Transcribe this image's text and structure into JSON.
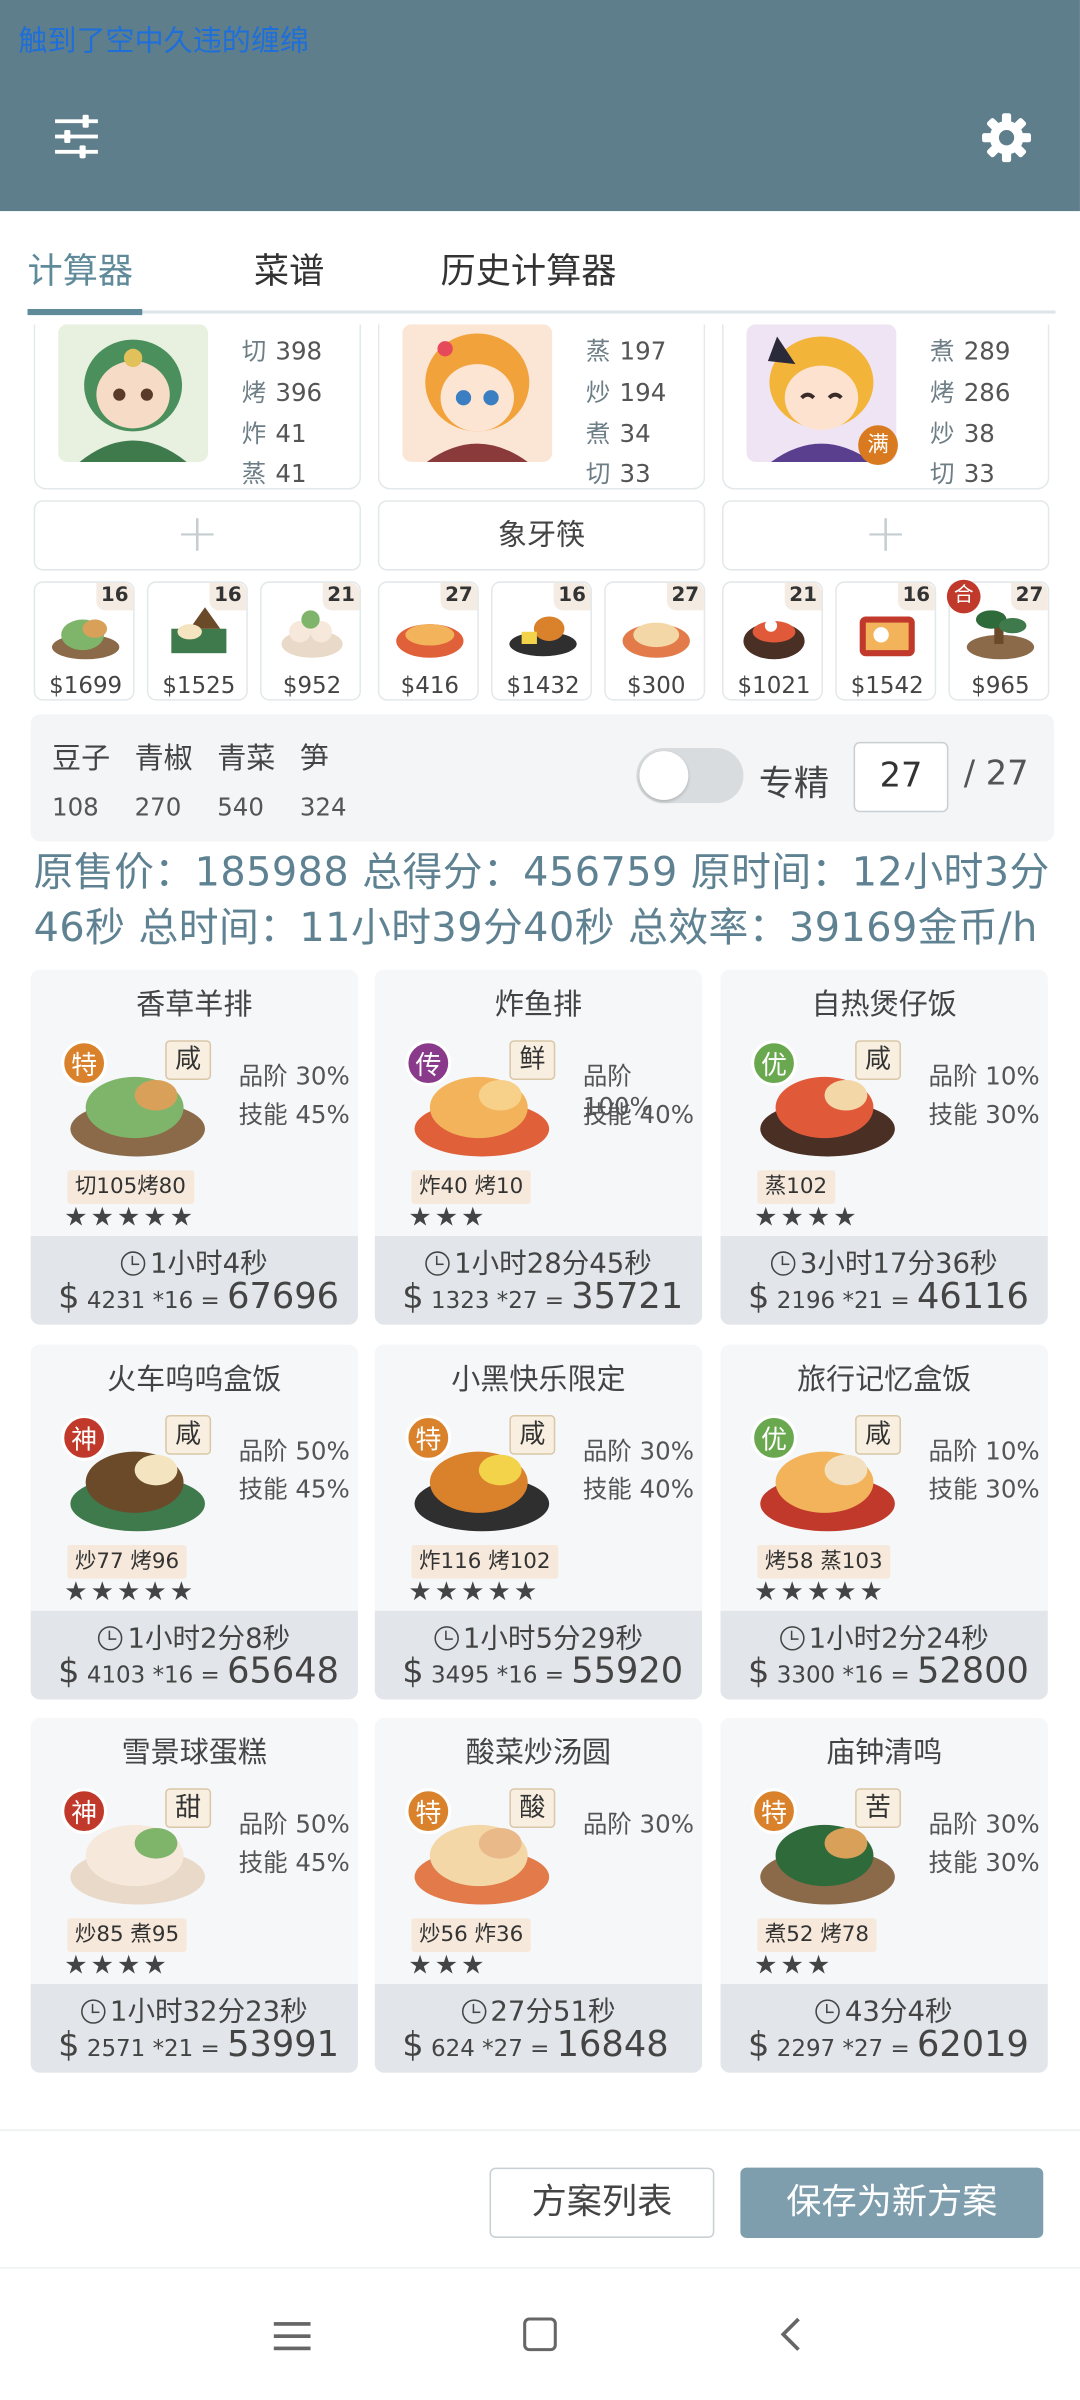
{
  "app": {
    "title": "触到了空中久违的缠绵"
  },
  "tabs": [
    "计算器",
    "菜谱",
    "历史计算器"
  ],
  "chefs": [
    {
      "skills": [
        {
          "k": "切",
          "v": "398"
        },
        {
          "k": "烤",
          "v": "396"
        },
        {
          "k": "炸",
          "v": "41"
        },
        {
          "k": "蒸",
          "v": "41"
        }
      ]
    },
    {
      "skills": [
        {
          "k": "蒸",
          "v": "197"
        },
        {
          "k": "炒",
          "v": "194"
        },
        {
          "k": "煮",
          "v": "34"
        },
        {
          "k": "切",
          "v": "33"
        }
      ]
    },
    {
      "skills": [
        {
          "k": "煮",
          "v": "289"
        },
        {
          "k": "烤",
          "v": "286"
        },
        {
          "k": "炒",
          "v": "38"
        },
        {
          "k": "切",
          "v": "33"
        }
      ],
      "badge": "满"
    }
  ],
  "equipment": {
    "middle": "象牙筷",
    "plus": "+"
  },
  "dish_strip": [
    {
      "count": "16",
      "price": "$1699"
    },
    {
      "count": "16",
      "price": "$1525"
    },
    {
      "count": "21",
      "price": "$952"
    },
    {
      "count": "27",
      "price": "$416"
    },
    {
      "count": "16",
      "price": "$1432"
    },
    {
      "count": "27",
      "price": "$300"
    },
    {
      "count": "21",
      "price": "$1021"
    },
    {
      "count": "16",
      "price": "$1542"
    },
    {
      "count": "27",
      "price": "$965",
      "tag": "合"
    }
  ],
  "ingredients": [
    {
      "name": "豆子",
      "value": "108"
    },
    {
      "name": "青椒",
      "value": "270"
    },
    {
      "name": "青菜",
      "value": "540"
    },
    {
      "name": "笋",
      "value": "324"
    }
  ],
  "mastery": {
    "label": "专精",
    "value": "27",
    "max": "/ 27",
    "enabled": false
  },
  "summary": {
    "line1": "原售价：185988 总得分：456759 原时间：12小时3分",
    "line2": "46秒 总时间：11小时39分40秒 总效率：39169金币/h"
  },
  "recipes": [
    {
      "name": "香草羊排",
      "rank": "特",
      "rank_color": "#d9822b",
      "flavor": "咸",
      "pinjie": "品阶 30%",
      "jineng": "技能 45%",
      "skills": "切105烤80",
      "stars": "★★★★★",
      "time": "1小时4秒",
      "price": "4231",
      "mult": "*16",
      "total": "67696"
    },
    {
      "name": "炸鱼排",
      "rank": "传",
      "rank_color": "#8a3a8a",
      "flavor": "鲜",
      "pinjie": "品阶 100%",
      "jineng": "技能 40%",
      "skills": "炸40 烤10",
      "stars": "★★★",
      "time": "1小时28分45秒",
      "price": "1323",
      "mult": "*27",
      "total": "35721"
    },
    {
      "name": "自热煲仔饭",
      "rank": "优",
      "rank_color": "#6aa84f",
      "flavor": "咸",
      "pinjie": "品阶 10%",
      "jineng": "技能 30%",
      "skills": "蒸102",
      "stars": "★★★★",
      "time": "3小时17分36秒",
      "price": "2196",
      "mult": "*21",
      "total": "46116"
    },
    {
      "name": "火车呜呜盒饭",
      "rank": "神",
      "rank_color": "#c0392b",
      "flavor": "咸",
      "pinjie": "品阶 50%",
      "jineng": "技能 45%",
      "skills": "炒77 烤96",
      "stars": "★★★★★",
      "time": "1小时2分8秒",
      "price": "4103",
      "mult": "*16",
      "total": "65648"
    },
    {
      "name": "小黑快乐限定",
      "rank": "特",
      "rank_color": "#d9822b",
      "flavor": "咸",
      "pinjie": "品阶 30%",
      "jineng": "技能 40%",
      "skills": "炸116 烤102",
      "stars": "★★★★★",
      "time": "1小时5分29秒",
      "price": "3495",
      "mult": "*16",
      "total": "55920"
    },
    {
      "name": "旅行记忆盒饭",
      "rank": "优",
      "rank_color": "#6aa84f",
      "flavor": "咸",
      "pinjie": "品阶 10%",
      "jineng": "技能 30%",
      "skills": "烤58 蒸103",
      "stars": "★★★★★",
      "time": "1小时2分24秒",
      "price": "3300",
      "mult": "*16",
      "total": "52800"
    },
    {
      "name": "雪景球蛋糕",
      "rank": "神",
      "rank_color": "#c0392b",
      "flavor": "甜",
      "pinjie": "品阶 50%",
      "jineng": "技能 45%",
      "skills": "炒85 煮95",
      "stars": "★★★★",
      "time": "1小时32分23秒",
      "price": "2571",
      "mult": "*21",
      "total": "53991"
    },
    {
      "name": "酸菜炒汤圆",
      "rank": "特",
      "rank_color": "#d9822b",
      "flavor": "酸",
      "pinjie": "品阶 30%",
      "jineng": "",
      "skills": "炒56 炸36",
      "stars": "★★★",
      "time": "27分51秒",
      "price": "624",
      "mult": "*27",
      "total": "16848"
    },
    {
      "name": "庙钟清鸣",
      "rank": "特",
      "rank_color": "#d9822b",
      "flavor": "苦",
      "pinjie": "品阶 30%",
      "jineng": "技能 30%",
      "skills": "煮52 烤78",
      "stars": "★★★",
      "time": "43分4秒",
      "price": "2297",
      "mult": "*27",
      "total": "62019"
    }
  ],
  "actions": {
    "plan_list": "方案列表",
    "save_new": "保存为新方案"
  },
  "icons": {
    "menu": "sliders-icon",
    "settings": "gear-icon",
    "nav_menu": "menu-icon",
    "nav_home": "home-icon",
    "nav_back": "back-icon"
  }
}
